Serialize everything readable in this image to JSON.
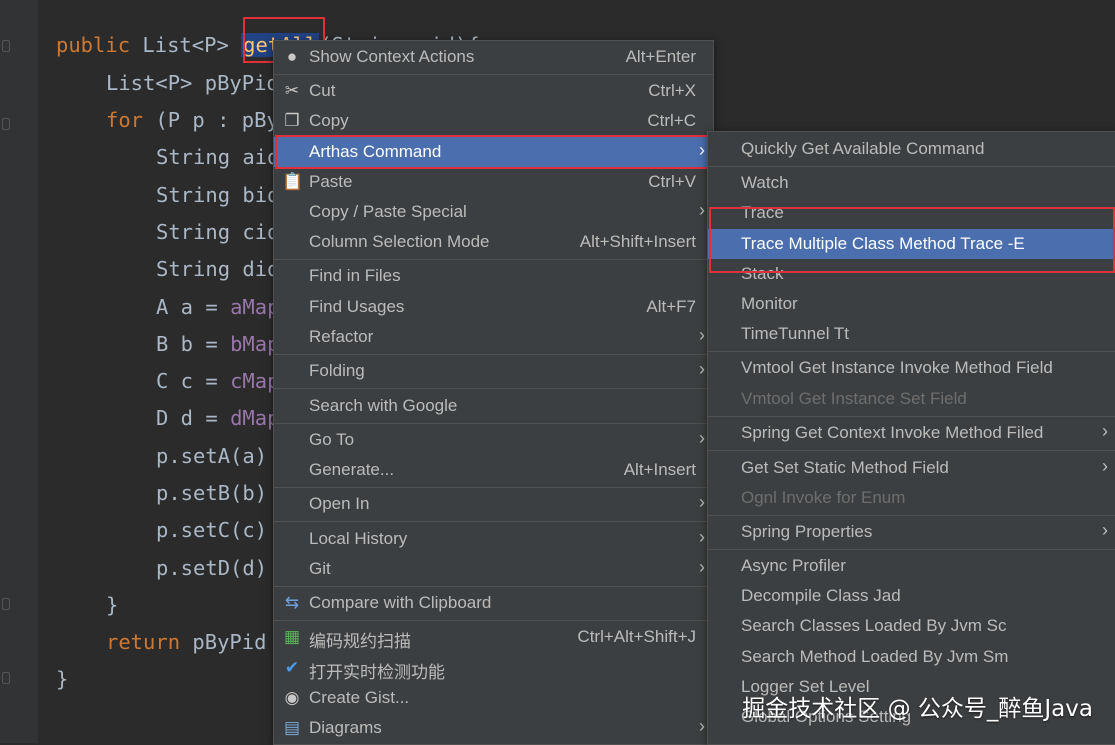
{
  "code": {
    "line1": {
      "kw": "public",
      "text": " List<P> ",
      "selected": "getAll",
      "rest": "(String pid){"
    },
    "line2": "List<P> pByPid",
    "line3": {
      "kw": "for",
      "text": " (P p : pBy"
    },
    "line4": "String aid",
    "line5": "String bid",
    "line6": "String cid",
    "line7": "String did",
    "line8": {
      "text": "A a = ",
      "fld": "aMap"
    },
    "line9": {
      "text": "B b = ",
      "fld": "bMap"
    },
    "line10": {
      "text": "C c = ",
      "fld": "cMap"
    },
    "line11": {
      "text": "D d = ",
      "fld": "dMap"
    },
    "line12": "p.setA(a)",
    "line13": "p.setB(b)",
    "line14": "p.setC(c)",
    "line15": "p.setD(d)",
    "line16": "}",
    "line17": {
      "kw": "return",
      "text": " pByPid"
    },
    "line18": "}"
  },
  "context_menu": {
    "items": [
      {
        "label": "Show Context Actions",
        "shortcut": "Alt+Enter",
        "icon": "lightbulb-icon"
      },
      {
        "label": "Cut",
        "shortcut": "Ctrl+X",
        "icon": "scissors-icon"
      },
      {
        "label": "Copy",
        "shortcut": "Ctrl+C",
        "icon": "copy-icon"
      },
      {
        "label": "Arthas Command",
        "shortcut": "",
        "icon": ""
      },
      {
        "label": "Paste",
        "shortcut": "Ctrl+V",
        "icon": "clipboard-icon"
      },
      {
        "label": "Copy / Paste Special",
        "shortcut": "",
        "icon": ""
      },
      {
        "label": "Column Selection Mode",
        "shortcut": "Alt+Shift+Insert",
        "icon": ""
      },
      {
        "label": "Find in Files",
        "shortcut": "",
        "icon": ""
      },
      {
        "label": "Find Usages",
        "shortcut": "Alt+F7",
        "icon": ""
      },
      {
        "label": "Refactor",
        "shortcut": "",
        "icon": ""
      },
      {
        "label": "Folding",
        "shortcut": "",
        "icon": ""
      },
      {
        "label": "Search with Google",
        "shortcut": "",
        "icon": ""
      },
      {
        "label": "Go To",
        "shortcut": "",
        "icon": ""
      },
      {
        "label": "Generate...",
        "shortcut": "Alt+Insert",
        "icon": ""
      },
      {
        "label": "Open In",
        "shortcut": "",
        "icon": ""
      },
      {
        "label": "Local History",
        "shortcut": "",
        "icon": ""
      },
      {
        "label": "Git",
        "shortcut": "",
        "icon": ""
      },
      {
        "label": "Compare with Clipboard",
        "shortcut": "",
        "icon": "compare-icon"
      },
      {
        "label": "编码规约扫描",
        "shortcut": "Ctrl+Alt+Shift+J",
        "icon": "scan-icon"
      },
      {
        "label": "打开实时检测功能",
        "shortcut": "",
        "icon": "check-circle-icon"
      },
      {
        "label": "Create Gist...",
        "shortcut": "",
        "icon": "github-icon"
      },
      {
        "label": "Diagrams",
        "shortcut": "",
        "icon": "diagram-icon"
      }
    ]
  },
  "submenu": {
    "items": [
      {
        "label": "Quickly Get Available Command"
      },
      {
        "label": "Watch"
      },
      {
        "label": "Trace"
      },
      {
        "label": "Trace Multiple Class Method Trace -E"
      },
      {
        "label": "Stack"
      },
      {
        "label": "Monitor"
      },
      {
        "label": "TimeTunnel Tt"
      },
      {
        "label": "Vmtool Get Instance Invoke Method Field"
      },
      {
        "label": "Vmtool Get Instance Set Field"
      },
      {
        "label": "Spring Get Context Invoke Method Filed"
      },
      {
        "label": "Get Set Static Method Field"
      },
      {
        "label": "Ognl Invoke for Enum"
      },
      {
        "label": "Spring Properties"
      },
      {
        "label": "Async Profiler"
      },
      {
        "label": "Decompile Class Jad"
      },
      {
        "label": "Search Classes Loaded By Jvm Sc"
      },
      {
        "label": "Search Method Loaded By Jvm Sm"
      },
      {
        "label": "Logger Set Level"
      },
      {
        "label": "Global Options Setting"
      }
    ]
  },
  "watermark": "掘金技术社区 @ 公众号_醉鱼Java",
  "colors": {
    "highlight": "#4b6eaf",
    "annotation_red": "#e0303a",
    "menu_bg": "#3c3f41",
    "editor_bg": "#2b2b2b"
  }
}
